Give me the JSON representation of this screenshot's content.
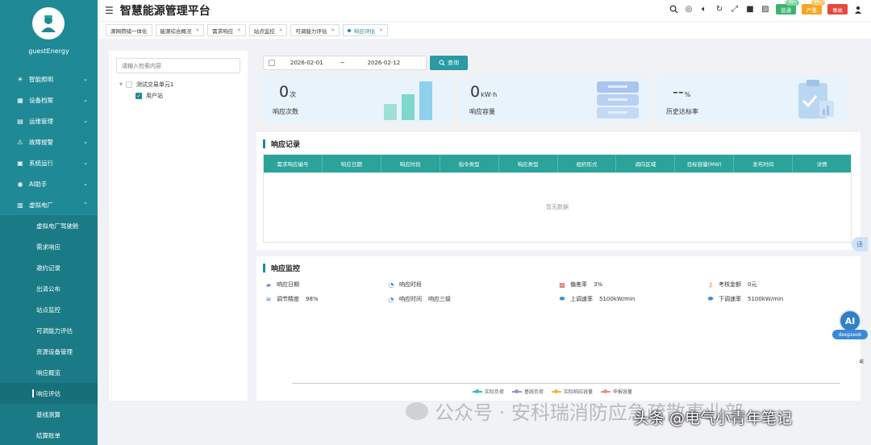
{
  "app": {
    "title": "智慧能源管理平台",
    "username": "guestEnergy"
  },
  "sidebar": {
    "items": [
      {
        "label": "智能照明",
        "icon": "bulb-icon"
      },
      {
        "label": "设备档案",
        "icon": "grid-icon"
      },
      {
        "label": "运维管理",
        "icon": "tools-icon"
      },
      {
        "label": "故障报警",
        "icon": "alarm-icon"
      },
      {
        "label": "系统运行",
        "icon": "system-icon"
      },
      {
        "label": "AI助手",
        "icon": "ai-icon"
      },
      {
        "label": "虚拟电厂",
        "icon": "building-icon"
      }
    ],
    "sub_items": [
      {
        "label": "虚拟电厂驾驶舱"
      },
      {
        "label": "需求响应"
      },
      {
        "label": "邀约记录"
      },
      {
        "label": "出清公布"
      },
      {
        "label": "站点监控"
      },
      {
        "label": "可调能力评估"
      },
      {
        "label": "资源设备管理"
      },
      {
        "label": "响应概览"
      },
      {
        "label": "响应评估"
      },
      {
        "label": "基线测算"
      },
      {
        "label": "结算账单"
      }
    ]
  },
  "header": {
    "buttons": [
      {
        "label": "普通",
        "color": "#3cb371",
        "badge": "99+"
      },
      {
        "label": "严重",
        "color": "#f5a623",
        "badge": "99+"
      },
      {
        "label": "事故",
        "color": "#e8483f",
        "badge": ""
      }
    ]
  },
  "tabs": [
    {
      "label": "源网荷储一体化"
    },
    {
      "label": "能源综合概况"
    },
    {
      "label": "需求响应"
    },
    {
      "label": "站点监控"
    },
    {
      "label": "可调能力评估"
    },
    {
      "label": "响应评估"
    }
  ],
  "tree": {
    "search_placeholder": "请输入检索内容",
    "root": "测试交易单元1",
    "child": "用户站"
  },
  "filter": {
    "date_from": "2026-02-01",
    "date_sep": "~",
    "date_to": "2026-02-12",
    "query_label": "查询"
  },
  "stats": [
    {
      "value": "0",
      "unit": "次",
      "label": "响应次数"
    },
    {
      "value": "0",
      "unit": "kW·h",
      "label": "响应容量"
    },
    {
      "value": "--",
      "unit": "%",
      "label": "历史达标率"
    }
  ],
  "records": {
    "title": "响应记录",
    "columns": [
      "需求响应编号",
      "响应日期",
      "响应时段",
      "指令类型",
      "响应类型",
      "组织形式",
      "调向区域",
      "目标容量(MW)",
      "发布时间",
      "详情"
    ],
    "empty_text": "暂无数据"
  },
  "monitor": {
    "title": "响应监控",
    "fields": [
      {
        "label": "响应日期",
        "value": ""
      },
      {
        "label": "响应时段",
        "value": ""
      },
      {
        "label": "偏差率",
        "value": "3%"
      },
      {
        "label": "考核金额",
        "value": "0元"
      },
      {
        "label": "调节精度",
        "value": "98%"
      },
      {
        "label": "响应时间",
        "value": "响应三级"
      },
      {
        "label": "上调速率",
        "value": "5100kW/min"
      },
      {
        "label": "下调速率",
        "value": "5100kW/min"
      }
    ],
    "legend": [
      {
        "name": "实际负荷",
        "color": "#3bb8c4"
      },
      {
        "name": "基线负荷",
        "color": "#9e8fd9"
      },
      {
        "name": "实际响应容量",
        "color": "#f3b53f"
      },
      {
        "name": "申报容量",
        "color": "#ef8a8a"
      }
    ]
  },
  "floating": {
    "translate": "译",
    "ai_text": "AI",
    "ai_tag": "deepseek"
  },
  "watermark": {
    "line1": "公众号 · 安科瑞消防应急疏散事业部",
    "line2": "头条 @电气小青年笔记"
  }
}
